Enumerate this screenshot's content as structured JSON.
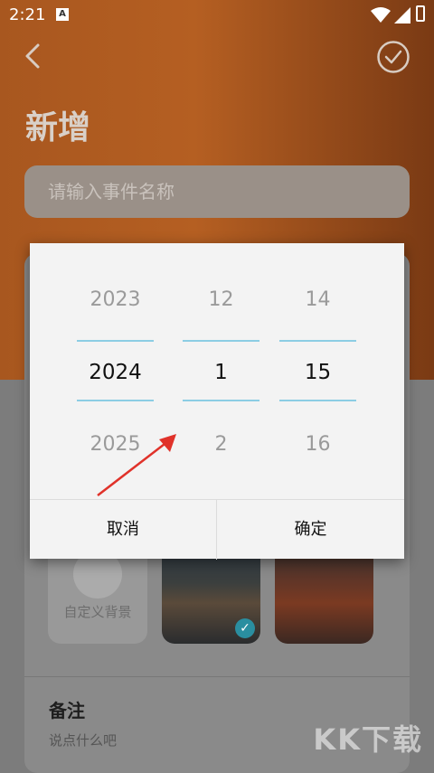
{
  "status": {
    "time": "2:21",
    "app_badge": "A"
  },
  "header": {
    "title": "新增"
  },
  "event_name": {
    "placeholder": "请输入事件名称"
  },
  "backgrounds": {
    "custom_label": "自定义背景",
    "selected_index": 1
  },
  "note": {
    "title": "备注",
    "placeholder": "说点什么吧"
  },
  "watermark": "KK下载",
  "date_picker": {
    "year": {
      "prev": "2023",
      "current": "2024",
      "next": "2025"
    },
    "month": {
      "prev": "12",
      "current": "1",
      "next": "2"
    },
    "day": {
      "prev": "14",
      "current": "15",
      "next": "16"
    },
    "cancel_label": "取消",
    "confirm_label": "确定"
  },
  "colors": {
    "accent": "#8ccde4",
    "header_bg": "#b55f22",
    "check_badge": "#2a8ea0",
    "annotation_arrow": "#e0322a"
  }
}
